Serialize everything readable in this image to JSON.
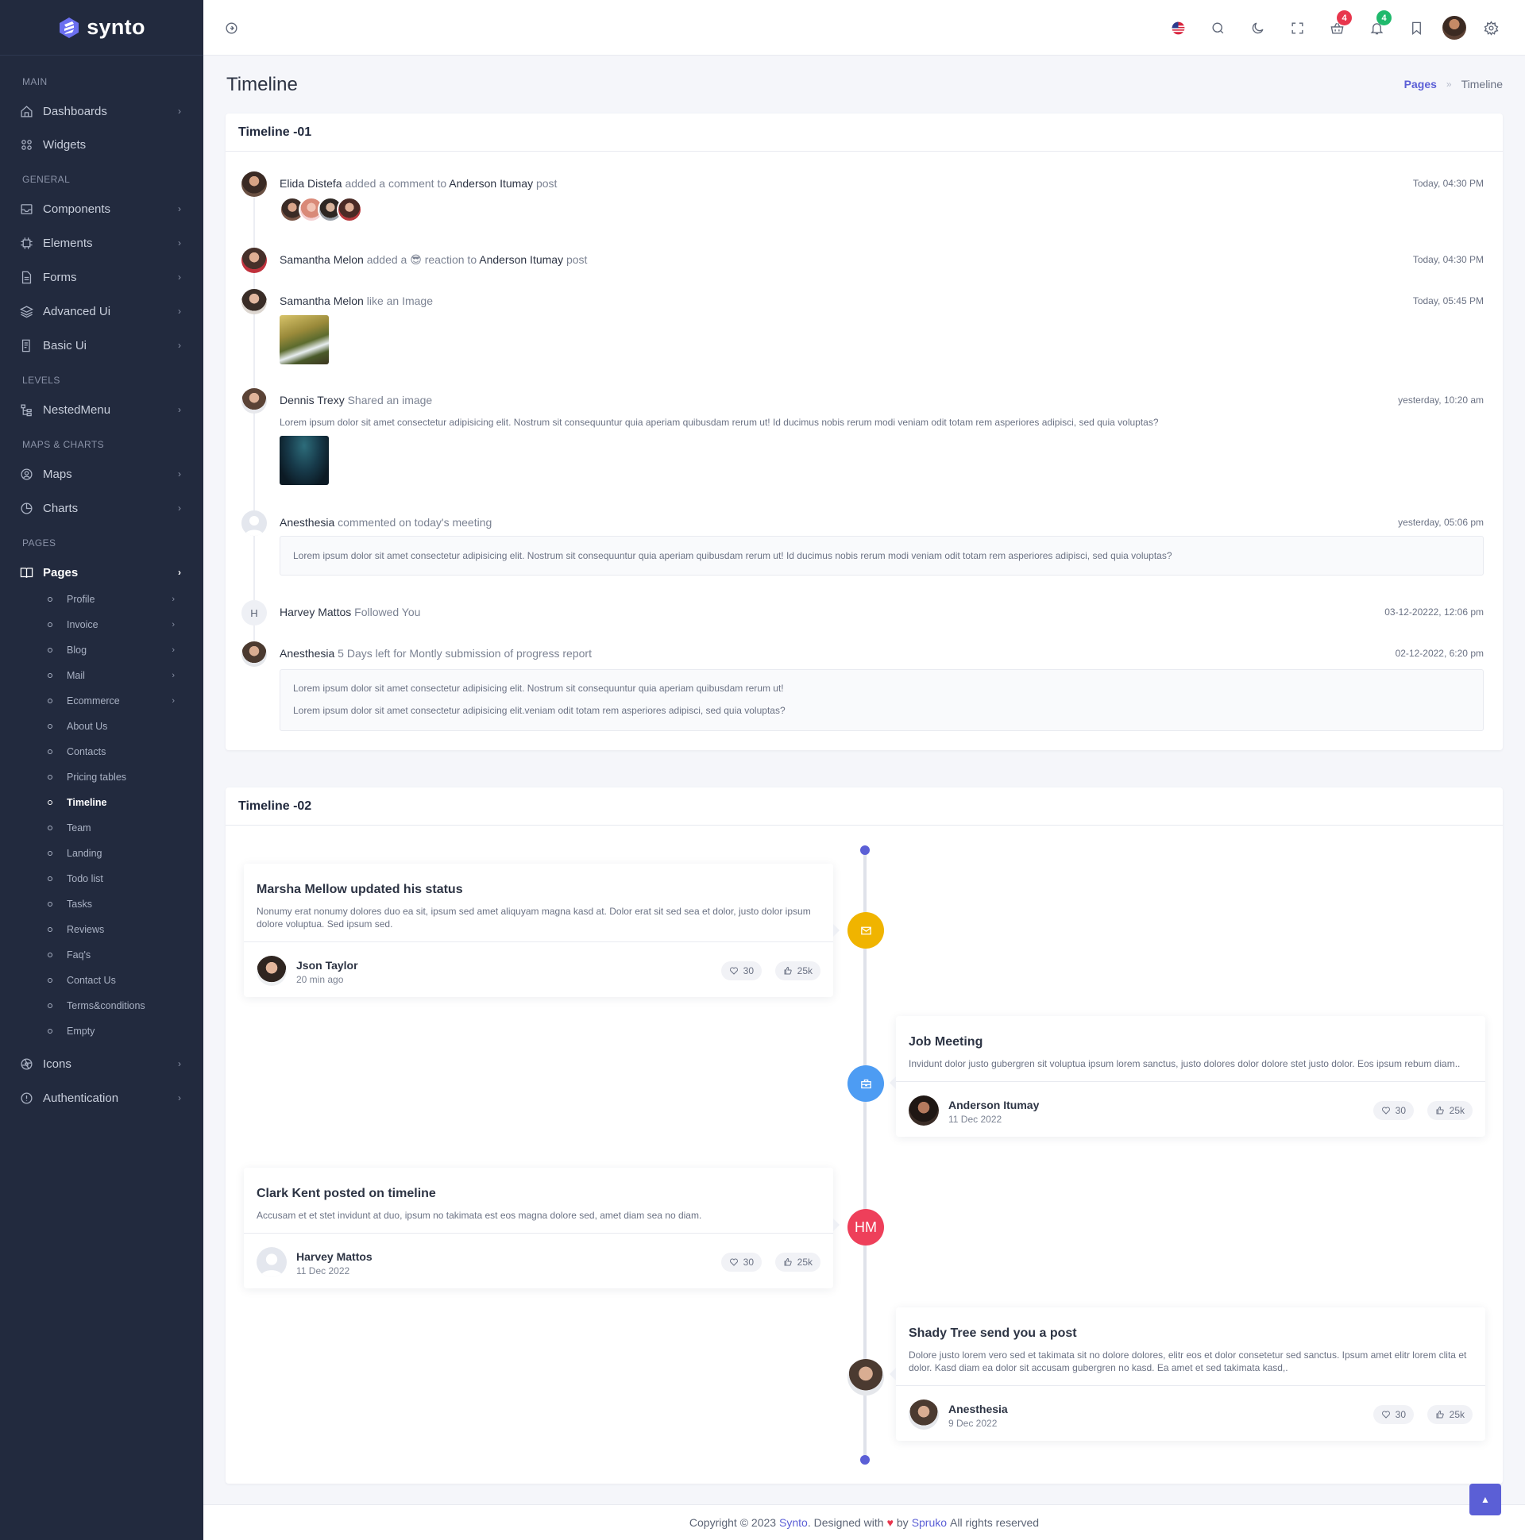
{
  "app": {
    "name": "synto",
    "page_title": "Timeline"
  },
  "colors": {
    "accent": "#5b5fd6",
    "sidebar_bg": "#222a3e",
    "badge_red": "#e8364d",
    "badge_green": "#1fb96c",
    "warning": "#f0b400",
    "info": "#4d9cf3",
    "danger": "#ee3f5a"
  },
  "sidebar": {
    "categories": [
      "MAIN",
      "GENERAL",
      "LEVELS",
      "MAPS & CHARTS",
      "PAGES"
    ],
    "items": [
      {
        "label": "Dashboards",
        "icon": "home-icon"
      },
      {
        "label": "Widgets",
        "icon": "grid-icon"
      },
      {
        "label": "Components",
        "icon": "inbox-icon"
      },
      {
        "label": "Elements",
        "icon": "cpu-icon"
      },
      {
        "label": "Forms",
        "icon": "file-icon"
      },
      {
        "label": "Advanced Ui",
        "icon": "layers-icon"
      },
      {
        "label": "Basic Ui",
        "icon": "file-text-icon"
      },
      {
        "label": "NestedMenu",
        "icon": "tree-icon"
      },
      {
        "label": "Maps",
        "icon": "map-pin-icon"
      },
      {
        "label": "Charts",
        "icon": "pie-chart-icon"
      },
      {
        "label": "Pages",
        "icon": "book-icon"
      },
      {
        "label": "Icons",
        "icon": "aperture-icon"
      },
      {
        "label": "Authentication",
        "icon": "info-icon"
      }
    ],
    "pages_sub": [
      "Profile",
      "Invoice",
      "Blog",
      "Mail",
      "Ecommerce",
      "About Us",
      "Contacts",
      "Pricing tables",
      "Timeline",
      "Team",
      "Landing",
      "Todo list",
      "Tasks",
      "Reviews",
      "Faq's",
      "Contact Us",
      "Terms&conditions",
      "Empty"
    ]
  },
  "header": {
    "cart_count": "4",
    "notification_count": "4"
  },
  "breadcrumb": {
    "parent": "Pages",
    "current": "Timeline"
  },
  "timeline1": {
    "title": "Timeline -01",
    "entries": [
      {
        "name": "Elida Distefa",
        "action": "added a comment to",
        "target": "Anderson Itumay",
        "suffix": "post",
        "time": "Today, 04:30 PM"
      },
      {
        "name": "Samantha Melon",
        "action": "added a",
        "emoji": "😎",
        "action2": "reaction to",
        "target": "Anderson Itumay",
        "suffix": "post",
        "time": "Today, 04:30 PM"
      },
      {
        "name": "Samantha Melon",
        "action": "like an Image",
        "time": "Today, 05:45 PM"
      },
      {
        "name": "Dennis Trexy",
        "action": "Shared an image",
        "time": "yesterday, 10:20 am",
        "desc": "Lorem ipsum dolor sit amet consectetur adipisicing elit. Nostrum sit consequuntur quia aperiam quibusdam rerum ut! Id ducimus nobis rerum modi veniam odit totam rem asperiores adipisci, sed quia voluptas?"
      },
      {
        "name": "Anesthesia",
        "action": "commented on today's meeting",
        "time": "yesterday, 05:06 pm",
        "box": "Lorem ipsum dolor sit amet consectetur adipisicing elit. Nostrum sit consequuntur quia aperiam quibusdam rerum ut! Id ducimus nobis rerum modi veniam odit totam rem asperiores adipisci, sed quia voluptas?"
      },
      {
        "name": "Harvey Mattos",
        "action": "Followed You",
        "time": "03-12-20222, 12:06 pm",
        "initial": "H"
      },
      {
        "name": "Anesthesia",
        "action": "5 Days left for Montly submission of progress report",
        "time": "02-12-2022, 6:20 pm",
        "box1": "Lorem ipsum dolor sit amet consectetur adipisicing elit. Nostrum sit consequuntur quia aperiam quibusdam rerum ut!",
        "box2": "Lorem ipsum dolor sit amet consectetur adipisicing elit.veniam odit totam rem asperiores adipisci, sed quia voluptas?"
      }
    ]
  },
  "timeline2": {
    "title": "Timeline -02",
    "cards": [
      {
        "title": "Marsha Mellow updated his status",
        "body": "Nonumy erat nonumy dolores duo ea sit, ipsum sed amet aliquyam magna kasd at. Dolor erat sit sed sea et dolor, justo dolor ipsum dolore voluptua. Sed ipsum sed.",
        "author": "Json Taylor",
        "meta": "20 min ago",
        "likes": "30",
        "thumbs": "25k",
        "node_icon": "mail-icon"
      },
      {
        "title": "Job Meeting",
        "body": "Invidunt dolor justo gubergren sit voluptua ipsum lorem sanctus, justo dolores dolor dolore stet justo dolor. Eos ipsum rebum diam..",
        "author": "Anderson Itumay",
        "meta": "11 Dec 2022",
        "likes": "30",
        "thumbs": "25k",
        "node_icon": "briefcase-icon"
      },
      {
        "title": "Clark Kent posted on timeline",
        "body": "Accusam et et stet invidunt at duo, ipsum no takimata est eos magna dolore sed, amet diam sea no diam.",
        "author": "Harvey Mattos",
        "meta": "11 Dec 2022",
        "likes": "30",
        "thumbs": "25k",
        "node_text": "HM"
      },
      {
        "title": "Shady Tree send you a post",
        "body": "Dolore justo lorem vero sed et takimata sit no dolore dolores, elitr eos et dolor consetetur sed sanctus. Ipsum amet elitr lorem clita et dolor. Kasd diam ea dolor sit accusam gubergren no kasd. Ea amet et sed takimata kasd,.",
        "author": "Anesthesia",
        "meta": "9 Dec 2022",
        "likes": "30",
        "thumbs": "25k"
      }
    ]
  },
  "footer": {
    "prefix": "Copyright © 2023",
    "brand": "Synto",
    "designed": ". Designed with",
    "by": "by",
    "company": "Spruko",
    "suffix": "All rights reserved"
  }
}
